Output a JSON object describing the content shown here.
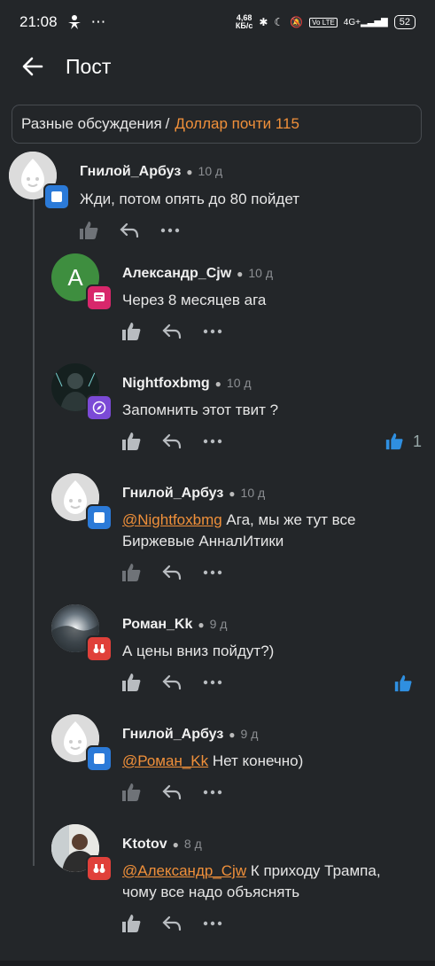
{
  "status": {
    "time": "21:08",
    "speed": "4,68\nКБ/с",
    "battery": "52"
  },
  "appbar": {
    "title": "Пост"
  },
  "breadcrumb": {
    "parent": "Разные обсуждения",
    "separator": "/",
    "current": "Доллар почти 115"
  },
  "colors": {
    "accent": "#f0903a",
    "like_active": "#2f8fe0",
    "bg": "#232629"
  },
  "comments": [
    {
      "author": "Гнилой_Арбуз",
      "age": "10 д",
      "text": "Жди, потом опять до 80 пойдет",
      "badge": "blue-square-badge"
    },
    {
      "author": "Александр_Cjw",
      "age": "10 д",
      "text": "Через 8 месяцев ага",
      "avatar_letter": "A",
      "badge": "pink-chat-badge"
    },
    {
      "author": "Nightfoxbmg",
      "age": "10 д",
      "text": "Запомнить этот твит ?",
      "likes": "1",
      "badge": "purple-compass-badge"
    },
    {
      "author": "Гнилой_Арбуз",
      "age": "10 д",
      "mention": "@Nightfoxbmg",
      "text": " Ага, мы же тут все",
      "text2": "Биржевые АнналИтики",
      "badge": "blue-square-badge"
    },
    {
      "author": "Роман_Kk",
      "age": "9 д",
      "text": "А цены вниз пойдут?)",
      "badge": "red-binoculars-badge"
    },
    {
      "author": "Гнилой_Арбуз",
      "age": "9 д",
      "mention": "@Роман_Kk",
      "text": " Нет конечно)",
      "badge": "blue-square-badge"
    },
    {
      "author": "Ktotov",
      "age": "8 д",
      "mention": "@Александр_Cjw",
      "text": " К приходу Трампа,",
      "text2": "чому все надо объяснять",
      "badge": "red-binoculars-badge"
    }
  ]
}
